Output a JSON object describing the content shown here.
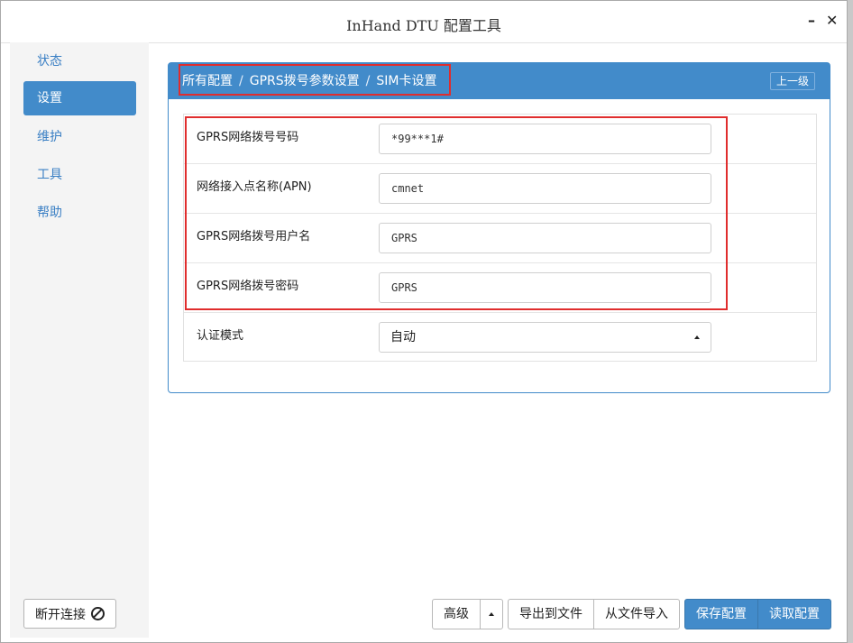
{
  "window": {
    "title": "InHand DTU 配置工具",
    "minimize": "–",
    "close": "✕"
  },
  "sidebar": {
    "items": [
      {
        "label": "状态"
      },
      {
        "label": "设置"
      },
      {
        "label": "维护"
      },
      {
        "label": "工具"
      },
      {
        "label": "帮助"
      }
    ],
    "active": "设置",
    "disconnect_label": "断开连接"
  },
  "breadcrumb": {
    "items": [
      "所有配置",
      "GPRS拨号参数设置",
      "SIM卡设置"
    ],
    "separator": "/"
  },
  "back_label": "上一级",
  "form": {
    "rows": [
      {
        "label": "GPRS网络拨号号码",
        "value": "*99***1#"
      },
      {
        "label": "网络接入点名称(APN)",
        "value": "cmnet"
      },
      {
        "label": "GPRS网络拨号用户名",
        "value": "GPRS"
      },
      {
        "label": "GPRS网络拨号密码",
        "value": "GPRS"
      }
    ],
    "auth_mode": {
      "label": "认证模式",
      "value": "自动"
    }
  },
  "footer": {
    "advanced": "高级",
    "export": "导出到文件",
    "import": "从文件导入",
    "save": "保存配置",
    "read": "读取配置"
  },
  "colors": {
    "accent": "#428bca",
    "highlight": "#e02d2d"
  },
  "icons": {
    "disconnect": "ban-icon",
    "auth_dropdown": "caret-up-icon",
    "advanced_dropdown": "caret-up-icon"
  }
}
